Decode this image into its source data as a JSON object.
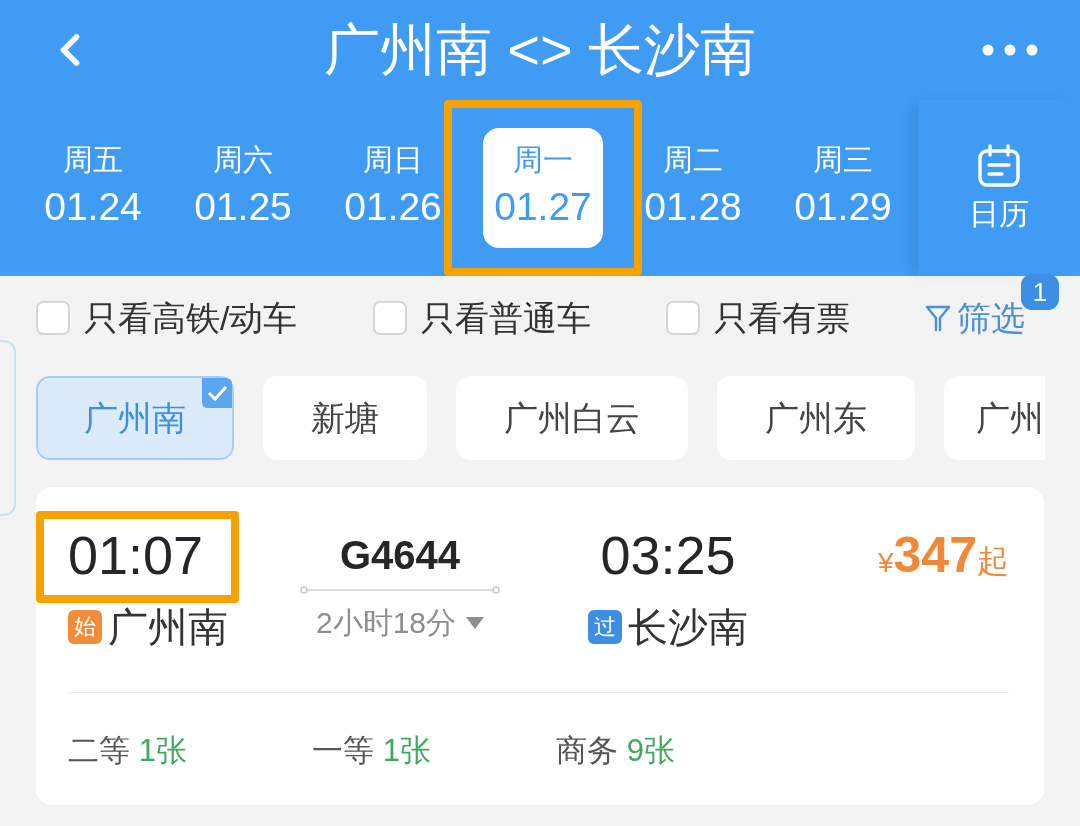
{
  "header": {
    "title": "广州南 <> 长沙南"
  },
  "dates": [
    {
      "weekday": "周五",
      "date": "01.24",
      "selected": false,
      "highlighted": false
    },
    {
      "weekday": "周六",
      "date": "01.25",
      "selected": false,
      "highlighted": false
    },
    {
      "weekday": "周日",
      "date": "01.26",
      "selected": false,
      "highlighted": false
    },
    {
      "weekday": "周一",
      "date": "01.27",
      "selected": true,
      "highlighted": true
    },
    {
      "weekday": "周二",
      "date": "01.28",
      "selected": false,
      "highlighted": false
    },
    {
      "weekday": "周三",
      "date": "01.29",
      "selected": false,
      "highlighted": false
    }
  ],
  "calendar": {
    "label": "日历"
  },
  "filters": [
    {
      "label": "只看高铁/动车",
      "checked": false
    },
    {
      "label": "只看普通车",
      "checked": false
    },
    {
      "label": "只看有票",
      "checked": false
    }
  ],
  "filter_button": {
    "label": "筛选",
    "badge": "1"
  },
  "stations": [
    {
      "name": "广州南",
      "selected": true
    },
    {
      "name": "新塘",
      "selected": false
    },
    {
      "name": "广州白云",
      "selected": false
    },
    {
      "name": "广州东",
      "selected": false
    },
    {
      "name": "广州",
      "selected": false
    }
  ],
  "train": {
    "depart": {
      "time": "01:07",
      "highlighted": true,
      "tag": {
        "kind": "start",
        "label": "始"
      },
      "station": "广州南"
    },
    "number": "G4644",
    "duration": "2小时18分",
    "arrive": {
      "time": "03:25",
      "tag": {
        "kind": "pass",
        "label": "过"
      },
      "station": "长沙南"
    },
    "price": {
      "currency": "¥",
      "amount": "347",
      "suffix": "起"
    },
    "seats": [
      {
        "class": "二等",
        "count": "1张"
      },
      {
        "class": "一等",
        "count": "1张"
      },
      {
        "class": "商务",
        "count": "9张"
      }
    ]
  }
}
